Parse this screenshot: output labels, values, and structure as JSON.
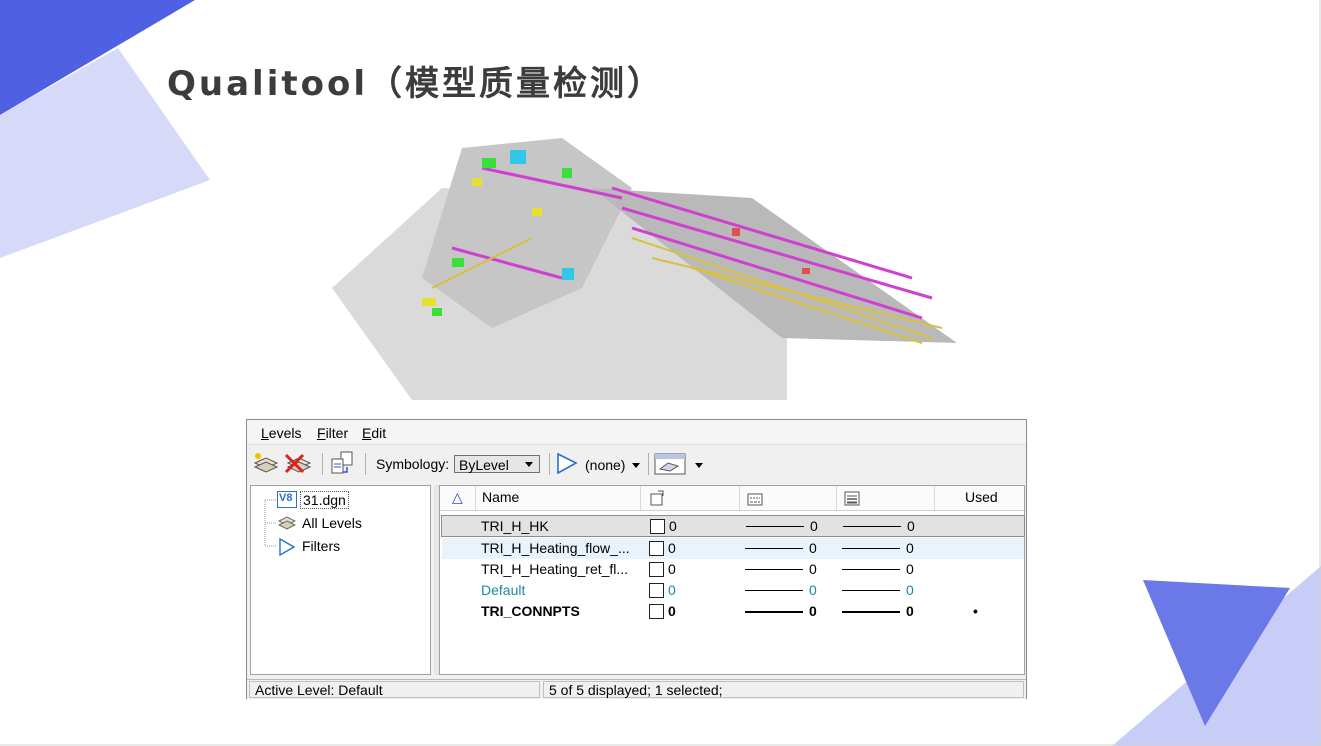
{
  "slide": {
    "title": "Qualitool（模型质量检测）"
  },
  "dialog": {
    "menu": [
      "Levels",
      "Filter",
      "Edit"
    ],
    "toolbar": {
      "symbology_label": "Symbology:",
      "symbology_value": "ByLevel",
      "filter_value": "(none)"
    },
    "tree": {
      "root": "31.dgn",
      "root_badge": "V8",
      "items": [
        "All Levels",
        "Filters"
      ]
    },
    "grid": {
      "sort_icon": "△",
      "columns": {
        "name": "Name",
        "used": "Used"
      },
      "rows": [
        {
          "name": "TRI_H_HK",
          "color": "0",
          "style": "0",
          "weight": "0",
          "used": "",
          "state": "selected"
        },
        {
          "name": "TRI_H_Heating_flow_...",
          "color": "0",
          "style": "0",
          "weight": "0",
          "used": "",
          "state": "hover"
        },
        {
          "name": "TRI_H_Heating_ret_fl...",
          "color": "0",
          "style": "0",
          "weight": "0",
          "used": "",
          "state": "normal"
        },
        {
          "name": "Default",
          "color": "0",
          "style": "0",
          "weight": "0",
          "used": "",
          "state": "active"
        },
        {
          "name": "TRI_CONNPTS",
          "color": "0",
          "style": "0",
          "weight": "0",
          "used": "•",
          "state": "bold"
        }
      ]
    },
    "status": {
      "active_level": "Active Level: Default",
      "count": "5 of 5 displayed; 1 selected;"
    }
  },
  "colors": {
    "accent_blue": "#4f5fe0",
    "active_level_text": "#1a8aa0"
  }
}
